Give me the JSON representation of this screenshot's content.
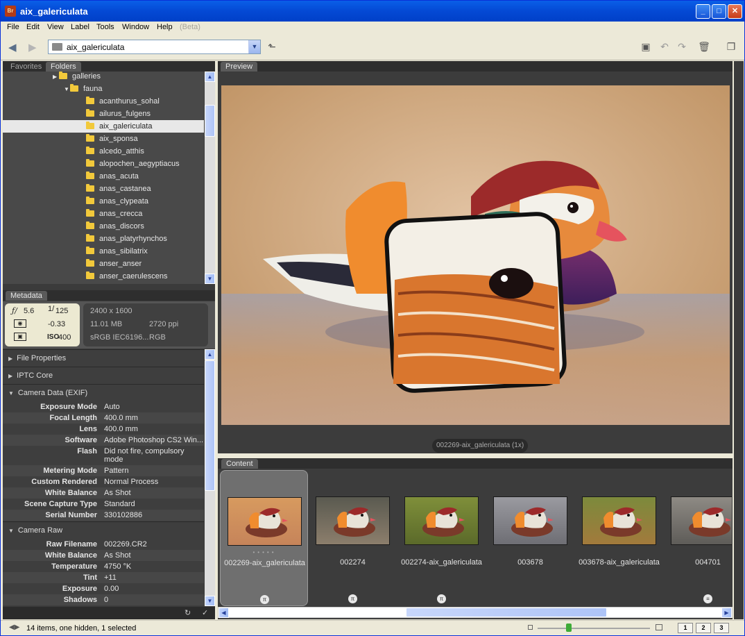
{
  "window": {
    "title": "aix_galericulata",
    "app_icon": "Br"
  },
  "menu": [
    "File",
    "Edit",
    "View",
    "Label",
    "Tools",
    "Window",
    "Help"
  ],
  "menu_beta": "(Beta)",
  "toolbar": {
    "path": "aix_galericulata"
  },
  "left_tabs": {
    "favorites": "Favorites",
    "folders": "Folders"
  },
  "folders": [
    {
      "label": "galleries",
      "indent": 1,
      "expander": "▶"
    },
    {
      "label": "fauna",
      "indent": 2,
      "expander": "▼"
    },
    {
      "label": "acanthurus_sohal",
      "indent": 3
    },
    {
      "label": "ailurus_fulgens",
      "indent": 3
    },
    {
      "label": "aix_galericulata",
      "indent": 3,
      "selected": true
    },
    {
      "label": "aix_sponsa",
      "indent": 3
    },
    {
      "label": "alcedo_atthis",
      "indent": 3
    },
    {
      "label": "alopochen_aegyptiacus",
      "indent": 3
    },
    {
      "label": "anas_acuta",
      "indent": 3
    },
    {
      "label": "anas_castanea",
      "indent": 3
    },
    {
      "label": "anas_clypeata",
      "indent": 3
    },
    {
      "label": "anas_crecca",
      "indent": 3
    },
    {
      "label": "anas_discors",
      "indent": 3
    },
    {
      "label": "anas_platyrhynchos",
      "indent": 3
    },
    {
      "label": "anas_sibilatrix",
      "indent": 3
    },
    {
      "label": "anser_anser",
      "indent": 3
    },
    {
      "label": "anser_caerulescens",
      "indent": 3
    }
  ],
  "metadata_tab": "Metadata",
  "exif_box": {
    "aperture": "5.6",
    "shutter": "125",
    "ev": "-0.33",
    "iso_label": "ISO",
    "iso": "400"
  },
  "file_box": {
    "dimensions": "2400 x 1600",
    "size": "11.01 MB",
    "ppi": "2720 ppi",
    "profile": "sRGB IEC6196...",
    "mode": "RGB"
  },
  "sections": {
    "file_properties": "File Properties",
    "iptc": "IPTC Core",
    "camera_data": "Camera Data (EXIF)",
    "camera_raw": "Camera Raw"
  },
  "camera_data": [
    {
      "k": "Exposure Mode",
      "v": "Auto"
    },
    {
      "k": "Focal Length",
      "v": "400.0 mm"
    },
    {
      "k": "Lens",
      "v": "400.0 mm"
    },
    {
      "k": "Software",
      "v": "Adobe Photoshop CS2 Win..."
    },
    {
      "k": "Flash",
      "v": "Did not fire, compulsory",
      "v2": "mode"
    },
    {
      "k": "Metering Mode",
      "v": "Pattern"
    },
    {
      "k": "Custom Rendered",
      "v": "Normal Process"
    },
    {
      "k": "White Balance",
      "v": "As Shot"
    },
    {
      "k": "Scene Capture Type",
      "v": "Standard"
    },
    {
      "k": "Serial Number",
      "v": "330102886"
    }
  ],
  "camera_raw": [
    {
      "k": "Raw Filename",
      "v": "002269.CR2"
    },
    {
      "k": "White Balance",
      "v": "As Shot"
    },
    {
      "k": "Temperature",
      "v": "4750 °K"
    },
    {
      "k": "Tint",
      "v": "+11"
    },
    {
      "k": "Exposure",
      "v": "0.00"
    },
    {
      "k": "Shadows",
      "v": "0"
    }
  ],
  "preview_tab": "Preview",
  "preview_caption": "002269-aix_galericulata (1x)",
  "content_tab": "Content",
  "thumbnails": [
    {
      "label": "002269-aix_galericulata",
      "selected": true
    },
    {
      "label": "002274"
    },
    {
      "label": "002274-aix_galericulata"
    },
    {
      "label": "003678"
    },
    {
      "label": "003678-aix_galericulata"
    },
    {
      "label": "004701"
    }
  ],
  "status": {
    "text": "14 items, one hidden, 1 selected"
  },
  "view_buttons": [
    "1",
    "2",
    "3"
  ],
  "colors": {
    "panel_dark": "#3c3c3c",
    "selection": "#e8e8e8",
    "folder": "#f2c93b",
    "titlebar": "#0449d4"
  }
}
